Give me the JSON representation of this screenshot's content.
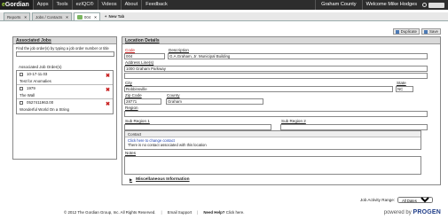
{
  "topbar": {
    "logo": "eGordian",
    "menu": [
      "Apps",
      "Tools",
      "ezIQC®",
      "Videos",
      "About",
      "Feedback"
    ],
    "county": "Graham County",
    "welcome": "Welcome Mike Hodges"
  },
  "tabs": [
    {
      "label": "Reports",
      "active": false
    },
    {
      "label": "Jobs / Contacts",
      "active": false
    },
    {
      "label": "004",
      "active": true
    }
  ],
  "new_tab_label": "New Tab",
  "toolbar": {
    "duplicate": "Duplicate",
    "save": "Save"
  },
  "associated_jobs": {
    "title": "Associated Jobs",
    "hint": "Find the job order(s) by typing a job order number or title",
    "search_value": "",
    "list_label": "Associated Job Order(s)",
    "orders": [
      {
        "number": "10-17-11.03",
        "name": "Test for Anomalies"
      },
      {
        "number": "1979",
        "name": "The Wall"
      },
      {
        "number": "0527411963.00",
        "name": "Wonderful World On a String"
      }
    ]
  },
  "location": {
    "title": "Location Details",
    "code_label": "Code",
    "code_value": "004",
    "description_label": "Description",
    "description_value": "G.A.Graham, Jr. Municipal Building",
    "address_label": "Address Line(s)",
    "address_line1": "1000 Graham Parkway",
    "address_line2": "",
    "city_label": "City",
    "city_value": "Robbinsville",
    "state_label": "State",
    "state_value": "NC",
    "zip_label": "Zip Code",
    "zip_value": "28771",
    "county_label": "County",
    "county_value": "Graham",
    "region_label": "Region",
    "region_value": "",
    "subregion1_label": "Sub Region 1",
    "subregion1_value": "",
    "subregion2_label": "Sub Region 2",
    "subregion2_value": "",
    "contact_label": "Contact",
    "contact_link": "Click here to change contact",
    "contact_none": "There is no contact associated with this location",
    "notes_label": "Notes",
    "misc_label": "Miscellaneous Information"
  },
  "job_activity": {
    "label": "Job Activity Range:",
    "value": "All Dates"
  },
  "footer": {
    "copyright": "© 2012 The Gordian Group, Inc. All Rights Reserved.",
    "email": "Email Support",
    "help_q": "Need Help?",
    "help_link": "Click here.",
    "powered_by": "powered by",
    "brand": "PROGEN"
  }
}
